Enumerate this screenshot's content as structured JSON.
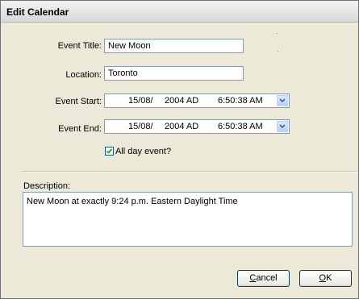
{
  "window": {
    "title": "Edit Calendar"
  },
  "form": {
    "event_title_label": "Event Title:",
    "event_title_value": "New Moon",
    "location_label": "Location:",
    "location_value": "Toronto",
    "event_start_label": "Event Start:",
    "event_start": {
      "date": "15/08/",
      "year": "2004 AD",
      "time": "6:50:38 AM"
    },
    "event_end_label": "Event End:",
    "event_end": {
      "date": "15/08/",
      "year": "2004 AD",
      "time": "6:50:38 AM"
    },
    "all_day_label": "All day event?",
    "all_day_checked": true,
    "description_label": "Description:",
    "description_value": "New Moon at exactly 9:24 p.m. Eastern Daylight Time"
  },
  "buttons": {
    "cancel_label": "Cancel",
    "cancel_mnemonic": "C",
    "cancel_rest": "ancel",
    "ok_label": "OK",
    "ok_mnemonic": "O",
    "ok_rest": "K"
  },
  "icons": {
    "dropdown": "chevron-down-icon",
    "check": "checkmark-icon"
  },
  "colors": {
    "dialog_bg": "#ece9d8",
    "field_border": "#7f9db9",
    "button_border": "#003c74",
    "dropdown_arrow": "#4d6185"
  }
}
